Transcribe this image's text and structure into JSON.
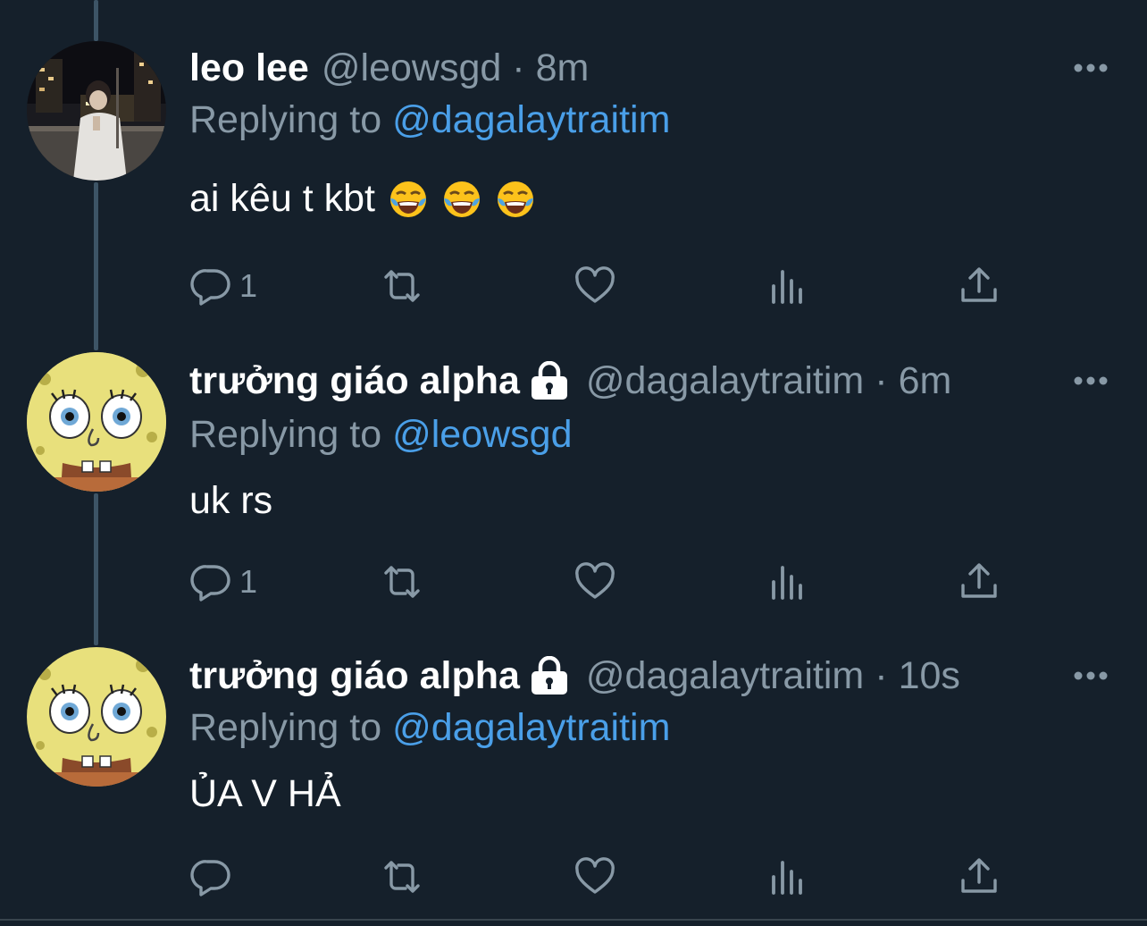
{
  "tweets": [
    {
      "display_name": "leo lee",
      "handle": "@leowsgd",
      "separator": "·",
      "time": "8m",
      "locked": false,
      "replying_prefix": "Replying to",
      "replying_to": "@dagalaytraitim",
      "text": "ai kêu t kbt",
      "emojis": [
        "face-with-tears-of-joy",
        "face-with-tears-of-joy",
        "face-with-tears-of-joy"
      ],
      "avatar_icon": "night-street-photo",
      "reply_count": "1",
      "retweet_count": "",
      "like_count": ""
    },
    {
      "display_name": "trưởng giáo alpha",
      "handle": "@dagalaytraitim",
      "separator": "·",
      "time": "6m",
      "locked": true,
      "replying_prefix": "Replying to",
      "replying_to": "@leowsgd",
      "text": "uk rs",
      "avatar_icon": "spongebob-face",
      "reply_count": "1",
      "retweet_count": "",
      "like_count": ""
    },
    {
      "display_name": "trưởng giáo alpha",
      "handle": "@dagalaytraitim",
      "separator": "·",
      "time": "10s",
      "locked": true,
      "replying_prefix": "Replying to",
      "replying_to": "@dagalaytraitim",
      "text": "ỦA V HẢ",
      "avatar_icon": "spongebob-face",
      "reply_count": "",
      "retweet_count": "",
      "like_count": ""
    }
  ],
  "icons": {
    "reply": "reply-icon",
    "retweet": "retweet-icon",
    "like": "heart-icon",
    "analytics": "analytics-icon",
    "share": "share-icon",
    "more": "more-icon",
    "lock": "lock-icon"
  },
  "colors": {
    "background": "#15202b",
    "secondary_text": "#8899a6",
    "mention": "#4a9fe8",
    "thread_line": "#3d5466"
  }
}
